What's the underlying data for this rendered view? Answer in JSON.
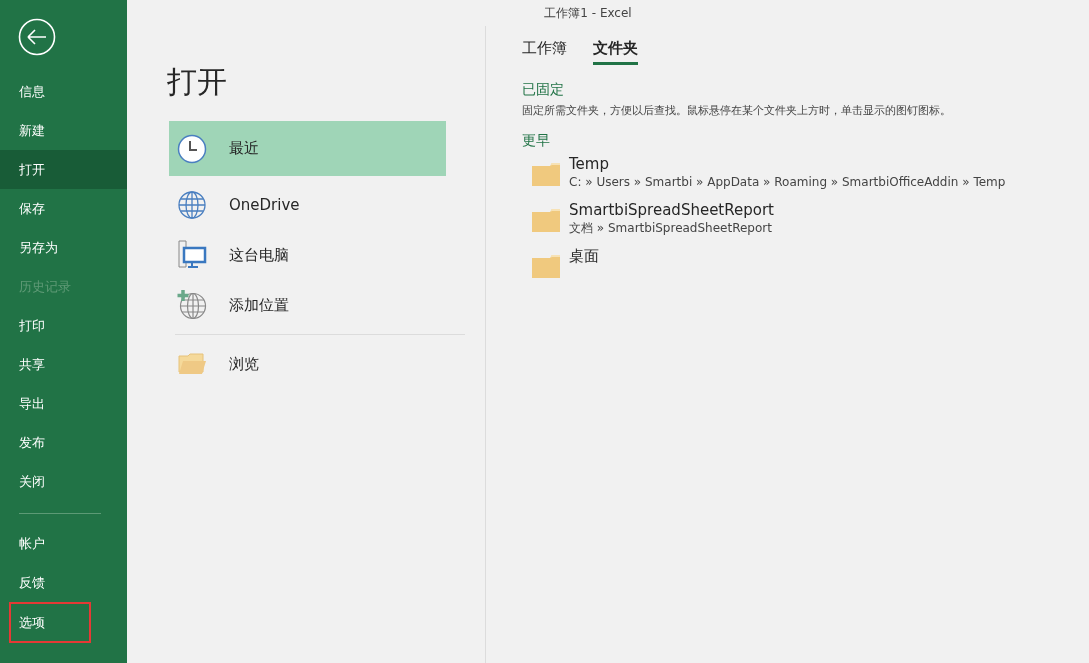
{
  "window": {
    "title": "工作簿1  -  Excel"
  },
  "sidebar": {
    "items": [
      {
        "label": "信息",
        "selected": false,
        "disabled": false
      },
      {
        "label": "新建",
        "selected": false,
        "disabled": false
      },
      {
        "label": "打开",
        "selected": true,
        "disabled": false
      },
      {
        "label": "保存",
        "selected": false,
        "disabled": false
      },
      {
        "label": "另存为",
        "selected": false,
        "disabled": false
      },
      {
        "label": "历史记录",
        "selected": false,
        "disabled": true
      },
      {
        "label": "打印",
        "selected": false,
        "disabled": false
      },
      {
        "label": "共享",
        "selected": false,
        "disabled": false
      },
      {
        "label": "导出",
        "selected": false,
        "disabled": false
      },
      {
        "label": "发布",
        "selected": false,
        "disabled": false
      },
      {
        "label": "关闭",
        "selected": false,
        "disabled": false
      }
    ],
    "footer_items": [
      {
        "label": "帐户",
        "highlighted": false
      },
      {
        "label": "反馈",
        "highlighted": false
      },
      {
        "label": "选项",
        "highlighted": true
      }
    ]
  },
  "page_title": "打开",
  "locations": [
    {
      "kind": "clock",
      "label": "最近",
      "selected": true
    },
    {
      "kind": "globe",
      "label": "OneDrive",
      "selected": false
    },
    {
      "kind": "computer",
      "label": "这台电脑",
      "selected": false
    },
    {
      "kind": "add",
      "label": "添加位置",
      "selected": false
    },
    {
      "kind": "browse",
      "label": "浏览",
      "selected": false
    }
  ],
  "tabs": [
    {
      "label": "工作簿",
      "selected": false
    },
    {
      "label": "文件夹",
      "selected": true
    }
  ],
  "pinned": {
    "heading": "已固定",
    "hint": "固定所需文件夹，方便以后查找。鼠标悬停在某个文件夹上方时，单击显示的图钉图标。"
  },
  "earlier": {
    "heading": "更早",
    "folders": [
      {
        "name": "Temp",
        "path": "C: » Users » Smartbi » AppData » Roaming » SmartbiOfficeAddin » Temp"
      },
      {
        "name": "SmartbiSpreadSheetReport",
        "path": "文档 » SmartbiSpreadSheetReport"
      },
      {
        "name": "桌面"
      }
    ]
  }
}
